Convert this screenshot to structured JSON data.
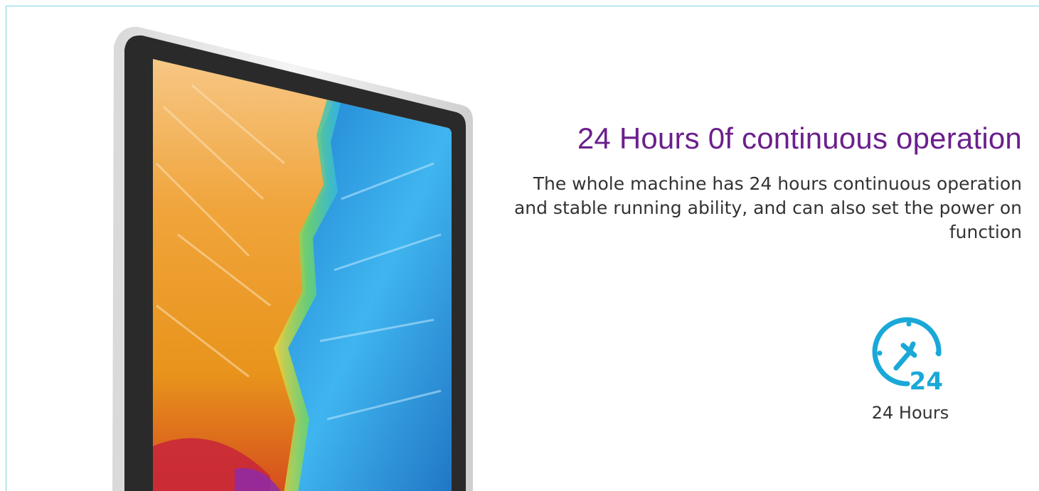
{
  "headline": "24 Hours 0f continuous operation",
  "description": "The whole machine has 24 hours continuous operation and stable running ability, and can also set the power on function",
  "feature": {
    "icon": "clock-24-icon",
    "icon_text": "24",
    "label": "24 Hours"
  },
  "colors": {
    "headline": "#6b1f8c",
    "accent": "#1aa8d8",
    "body_text": "#333333",
    "border": "#7fd3e6"
  }
}
